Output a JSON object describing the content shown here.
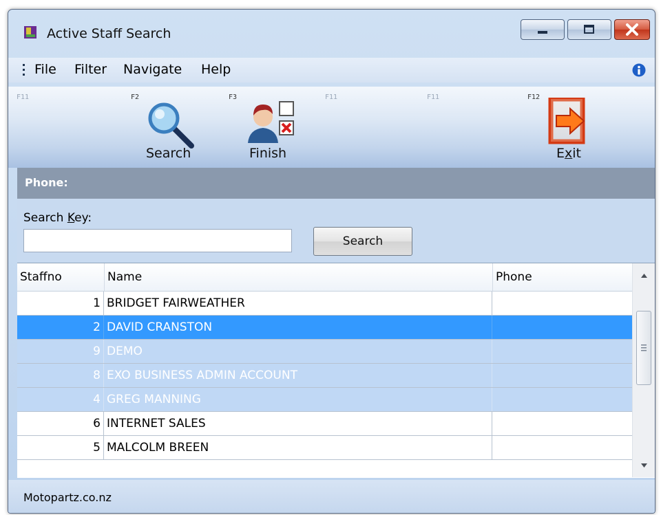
{
  "window": {
    "title": "Active Staff Search"
  },
  "menu": {
    "items": [
      "File",
      "Filter",
      "Navigate",
      "Help"
    ]
  },
  "toolbar": {
    "keys": [
      "F11",
      "F2",
      "F3",
      "F11",
      "F11",
      "F12"
    ],
    "search_label": "Search",
    "finish_label": "Finish",
    "exit_label": "Exit"
  },
  "phone_label": "Phone:",
  "search": {
    "key_label": "Search Key:",
    "value": "",
    "button_label": "Search"
  },
  "grid": {
    "columns": [
      "Staffno",
      "Name",
      "Phone"
    ],
    "rows": [
      {
        "staffno": "1",
        "name": "BRIDGET FAIRWEATHER",
        "phone": "",
        "state": "normal"
      },
      {
        "staffno": "2",
        "name": "DAVID CRANSTON",
        "phone": "",
        "state": "selected"
      },
      {
        "staffno": "9",
        "name": "DEMO",
        "phone": "",
        "state": "multiselected"
      },
      {
        "staffno": "8",
        "name": "EXO BUSINESS ADMIN ACCOUNT",
        "phone": "",
        "state": "multiselected"
      },
      {
        "staffno": "4",
        "name": "GREG MANNING",
        "phone": "",
        "state": "multiselected"
      },
      {
        "staffno": "6",
        "name": "INTERNET SALES",
        "phone": "",
        "state": "normal"
      },
      {
        "staffno": "5",
        "name": "MALCOLM BREEN",
        "phone": "",
        "state": "normal"
      }
    ]
  },
  "status": {
    "text": "Motopartz.co.nz"
  },
  "colors": {
    "selection": "#3399ff",
    "multiselect": "#c0d8f5",
    "band": "#8a99ad"
  },
  "icons": [
    "app-icon",
    "info-icon",
    "search-magnifier-icon",
    "finish-person-icon",
    "exit-door-icon"
  ]
}
